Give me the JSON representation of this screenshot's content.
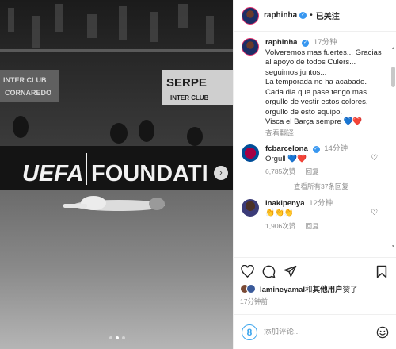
{
  "photo": {
    "board_left": "UEFA",
    "board_right": "FOUNDATI",
    "banner_left_1": "INTER CLUB",
    "banner_left_2": "CORNAREDO",
    "banner_right_1": "SERPE",
    "banner_right_2": "INTER CLUB",
    "slides": 3,
    "active_slide": 2,
    "next_icon": "chevron-right-icon"
  },
  "header": {
    "username": "raphinha",
    "separator": "•",
    "follow_label": "已关注"
  },
  "caption": {
    "username": "raphinha",
    "time": "17分钟",
    "text": "Volveremos mas fuertes... Gracias al apoyo de todos Culers... seguimos juntos...\nLa temporada no ha acabado. Cada dia que pase tengo mas orgullo de vestir estos colores, orgullo de esto equipo.\nVisca el Barça sempre 💙❤️",
    "see_translation": "查看翻译"
  },
  "comments": [
    {
      "username": "fcbarcelona",
      "time": "14分钟",
      "text": "Orgull 💙❤️",
      "likes": "6,785次赞",
      "reply": "回复",
      "more_replies": "查看所有37条回复"
    },
    {
      "username": "inakipenya",
      "time": "12分钟",
      "text": "👏👏👏",
      "likes": "1,906次赞",
      "reply": "回复"
    }
  ],
  "likes": {
    "user": "lamineyamal",
    "connector": "和",
    "others": "其他用户",
    "suffix": "赞了"
  },
  "posted_time": "17分钟前",
  "add_comment": {
    "avatar_letter": "8",
    "placeholder": "添加评论..."
  },
  "colors": {
    "verified": "#3897f0",
    "muted": "#8e8e8e",
    "text": "#262626",
    "heart_red": "#e0245e",
    "heart_blue": "#1f6fd6"
  },
  "icons": [
    "verified-badge-icon",
    "heart-icon",
    "comment-icon",
    "share-icon",
    "bookmark-icon",
    "emoji-icon"
  ]
}
